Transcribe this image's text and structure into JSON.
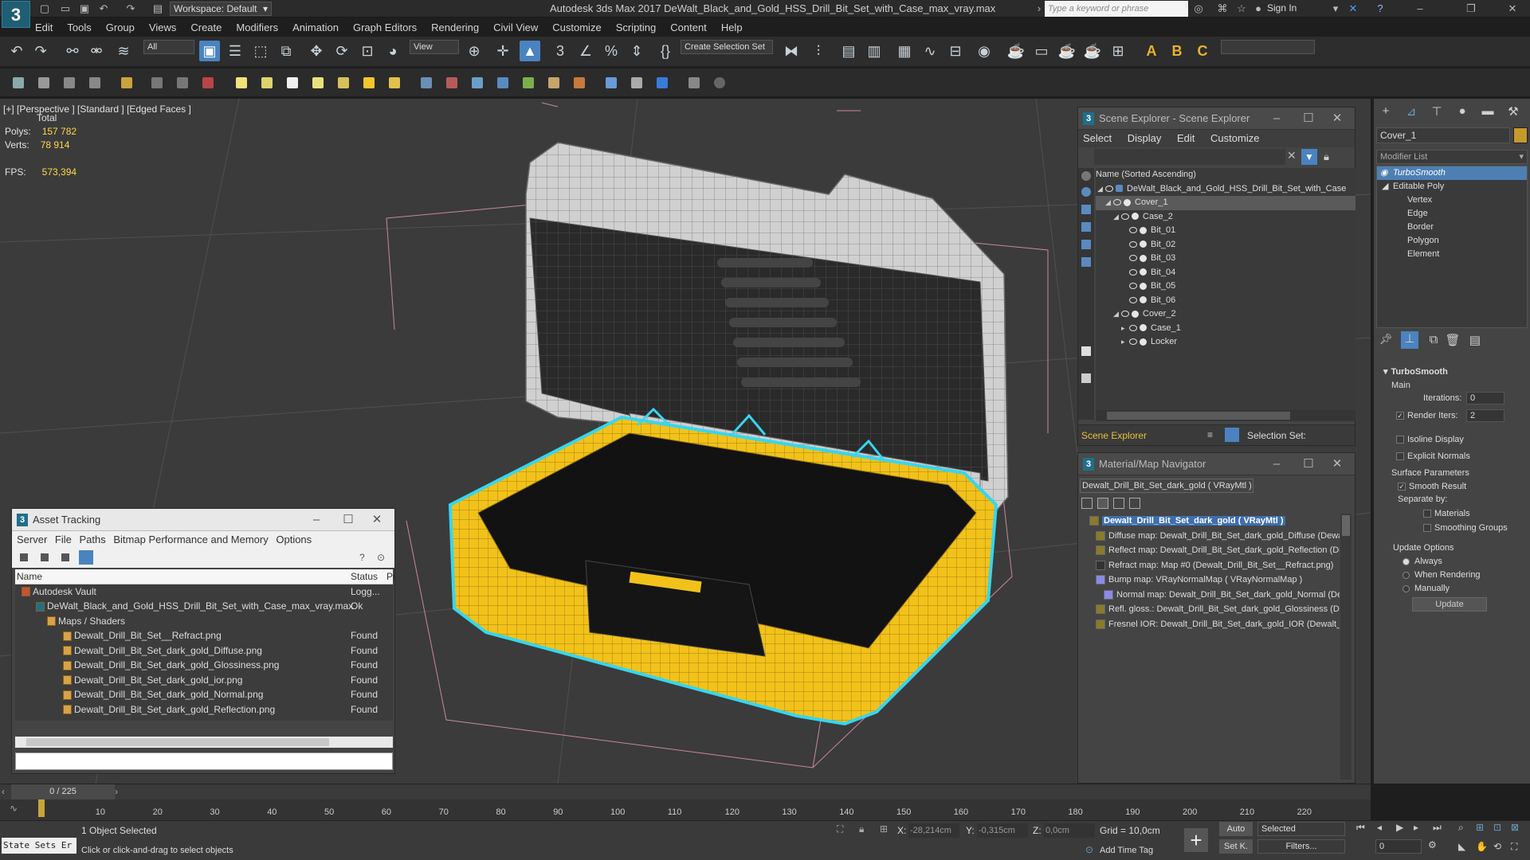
{
  "app": {
    "logo": "3",
    "workspace": "Workspace: Default",
    "title": "Autodesk 3ds Max 2017      DeWalt_Black_and_Gold_HSS_Drill_Bit_Set_with_Case_max_vray.max",
    "search_placeholder": "Type a keyword or phrase",
    "sign_in": "Sign In"
  },
  "menus": [
    "Edit",
    "Tools",
    "Group",
    "Views",
    "Create",
    "Modifiers",
    "Animation",
    "Graph Editors",
    "Rendering",
    "Civil View",
    "Customize",
    "Scripting",
    "Content",
    "Help"
  ],
  "toolbar": {
    "filter": "All",
    "view": "View",
    "selection_set": "Create Selection Set"
  },
  "viewport": {
    "label": "[+] [Perspective ] [Standard ] [Edged Faces ]",
    "stats_total": "Total",
    "polys_label": "Polys:",
    "polys": "157 782",
    "verts_label": "Verts:",
    "verts": "78 914",
    "fps_label": "FPS:",
    "fps": "573,394"
  },
  "scene_explorer": {
    "title": "Scene Explorer - Scene Explorer",
    "menu": [
      "Select",
      "Display",
      "Edit",
      "Customize"
    ],
    "column": "Name (Sorted Ascending)",
    "items": [
      {
        "name": "DeWalt_Black_and_Gold_HSS_Drill_Bit_Set_with_Case",
        "level": 0
      },
      {
        "name": "Cover_1",
        "level": 1
      },
      {
        "name": "Case_2",
        "level": 1
      },
      {
        "name": "Bit_01",
        "level": 2
      },
      {
        "name": "Bit_02",
        "level": 2
      },
      {
        "name": "Bit_03",
        "level": 2
      },
      {
        "name": "Bit_04",
        "level": 2
      },
      {
        "name": "Bit_05",
        "level": 2
      },
      {
        "name": "Bit_06",
        "level": 2
      },
      {
        "name": "Cover_2",
        "level": 1
      },
      {
        "name": "Case_1",
        "level": 2
      },
      {
        "name": "Locker",
        "level": 2
      }
    ],
    "footer_left": "Scene Explorer",
    "footer_right": "Selection Set:"
  },
  "material_nav": {
    "title": "Material/Map Navigator",
    "current": "Dewalt_Drill_Bit_Set_dark_gold  ( VRayMtl )",
    "items": [
      "Dewalt_Drill_Bit_Set_dark_gold  ( VRayMtl )",
      "Diffuse map: Dewalt_Drill_Bit_Set_dark_gold_Diffuse (Dewalt_",
      "Reflect map: Dewalt_Drill_Bit_Set_dark_gold_Reflection (Dew",
      "Refract map: Map #0 (Dewalt_Drill_Bit_Set__Refract.png)",
      "Bump map: VRayNormalMap  ( VRayNormalMap )",
      "Normal map: Dewalt_Drill_Bit_Set_dark_gold_Normal (Dewa",
      "Refl. gloss.: Dewalt_Drill_Bit_Set_dark_gold_Glossiness (Dewa",
      "Fresnel IOR: Dewalt_Drill_Bit_Set_dark_gold_IOR (Dewalt_Dr"
    ]
  },
  "asset_tracking": {
    "title": "Asset Tracking",
    "menu": [
      "Server",
      "File",
      "Paths",
      "Bitmap Performance and Memory",
      "Options"
    ],
    "col_name": "Name",
    "col_status": "Status",
    "col_p": "Pr",
    "rows": [
      {
        "name": "Autodesk Vault",
        "status": "Logg..."
      },
      {
        "name": "DeWalt_Black_and_Gold_HSS_Drill_Bit_Set_with_Case_max_vray.max",
        "status": "Ok"
      },
      {
        "name": "Maps / Shaders",
        "status": ""
      },
      {
        "name": "Dewalt_Drill_Bit_Set__Refract.png",
        "status": "Found"
      },
      {
        "name": "Dewalt_Drill_Bit_Set_dark_gold_Diffuse.png",
        "status": "Found"
      },
      {
        "name": "Dewalt_Drill_Bit_Set_dark_gold_Glossiness.png",
        "status": "Found"
      },
      {
        "name": "Dewalt_Drill_Bit_Set_dark_gold_ior.png",
        "status": "Found"
      },
      {
        "name": "Dewalt_Drill_Bit_Set_dark_gold_Normal.png",
        "status": "Found"
      },
      {
        "name": "Dewalt_Drill_Bit_Set_dark_gold_Reflection.png",
        "status": "Found"
      }
    ]
  },
  "command_panel": {
    "object_name": "Cover_1",
    "modifier_list": "Modifier List",
    "stack": [
      "TurboSmooth",
      "Editable Poly",
      "Vertex",
      "Edge",
      "Border",
      "Polygon",
      "Element"
    ],
    "rollout": "TurboSmooth",
    "main": "Main",
    "iterations_label": "Iterations:",
    "iterations": "0",
    "render_iters_label": "Render Iters:",
    "render_iters": "2",
    "isoline": "Isoline Display",
    "explicit": "Explicit Normals",
    "surface_params": "Surface Parameters",
    "smooth_result": "Smooth Result",
    "separate_by": "Separate by:",
    "materials": "Materials",
    "smoothing_groups": "Smoothing Groups",
    "update_options": "Update Options",
    "always": "Always",
    "when_rendering": "When Rendering",
    "manually": "Manually",
    "update": "Update"
  },
  "timeline": {
    "frame": "0 / 225",
    "ticks": [
      "0",
      "10",
      "20",
      "30",
      "40",
      "50",
      "60",
      "70",
      "80",
      "90",
      "100",
      "110",
      "120",
      "130",
      "140",
      "150",
      "160",
      "170",
      "180",
      "190",
      "200",
      "210",
      "220"
    ]
  },
  "status": {
    "state_sets": "State Sets Er",
    "selected": "1 Object Selected",
    "hint": "Click or click-and-drag to select objects",
    "x_label": "X:",
    "x": "-28,214cm",
    "y_label": "Y:",
    "y": "-0,315cm",
    "z_label": "Z:",
    "z": "0,0cm",
    "grid": "Grid = 10,0cm",
    "add_time_tag": "Add Time Tag",
    "auto": "Auto",
    "set_k": "Set K.",
    "selected_dd": "Selected",
    "filters": "Filters...",
    "frame_field": "0"
  },
  "colors": {
    "accent": "#4a83bf",
    "case_yellow": "#f2c21b",
    "highlight": "#36d6f0",
    "stat_yellow": "#ffd84a"
  }
}
